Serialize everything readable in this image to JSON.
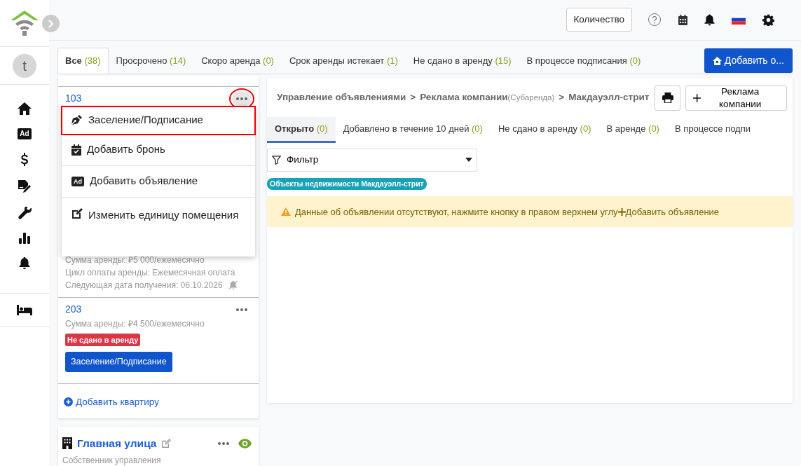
{
  "header": {
    "count_button": "Количество"
  },
  "sidebar": {
    "avatar": "t",
    "items": [
      {
        "kind": "home"
      },
      {
        "kind": "ad",
        "icon_text": "Ad"
      },
      {
        "kind": "dollar"
      },
      {
        "kind": "signature"
      },
      {
        "kind": "wrench"
      },
      {
        "kind": "chart"
      },
      {
        "kind": "bell"
      }
    ],
    "bottom_items": [
      {
        "kind": "bed"
      }
    ]
  },
  "tabs": [
    {
      "label": "Все",
      "count": "(38)",
      "selected": true
    },
    {
      "label": "Просрочено",
      "count": "(14)",
      "selected": false
    },
    {
      "label": "Скоро аренда",
      "count": "(0)",
      "selected": false
    },
    {
      "label": "Срок аренды истекает",
      "count": "(1)",
      "selected": false
    },
    {
      "label": "Не сдано в аренду",
      "count": "(15)",
      "selected": false
    },
    {
      "label": "В процессе подписания",
      "count": "(0)",
      "selected": false
    }
  ],
  "add_property_button": "Добавить о...",
  "units": [
    {
      "number": "103",
      "menu_open": true,
      "lines": [
        "Сумма аренды: ₽5 000/ежемесячно",
        "Цикл оплаты аренды: Ежемесячная оплата"
      ],
      "next_date_label": "Следующая дата получения:",
      "next_date": "06.10.2026",
      "reminder_muted": true
    },
    {
      "number": "203",
      "menu_open": false,
      "lines": [
        "Сумма аренды: ₽4 500/ежемесячно"
      ],
      "status": "Не сдано в аренду",
      "action": "Заселение/Подписание"
    }
  ],
  "add_unit": "Добавить квартиру",
  "context_menu": {
    "items": [
      {
        "kind": "sign",
        "label": "Заселение/Подписание",
        "highlighted": true
      },
      {
        "kind": "booking",
        "label": "Добавить бронь",
        "highlighted": false
      },
      {
        "kind": "ad",
        "icon_text": "Ad",
        "label": "Добавить объявление",
        "highlighted": false
      },
      {
        "kind": "edit",
        "label": "Изменить единицу помещения",
        "highlighted": false
      }
    ]
  },
  "second_property": {
    "name": "Главная улица",
    "subtitle": "Собственник управления"
  },
  "breadcrumb": [
    {
      "label": "Управление объявлениями"
    },
    {
      "separator": ">",
      "label": "Реклама компании",
      "note": "(Субаренда)"
    },
    {
      "separator": ">",
      "label": "Макдауэлл-стрит"
    }
  ],
  "company_ad_button": "Реклама компании",
  "listing_tabs": [
    {
      "label": "Открыто",
      "count": "(0)",
      "selected": true
    },
    {
      "label": "Добавлено в течение 10 дней",
      "count": "(0)",
      "selected": false
    },
    {
      "label": "Не сдано в аренду",
      "count": "(0)",
      "selected": false
    },
    {
      "label": "В аренде",
      "count": "(0)",
      "selected": false
    },
    {
      "label": "В процессе подпи",
      "selected": false
    }
  ],
  "filter": {
    "label": "Фильтр"
  },
  "tag": "Объекты недвижимости Макдауэлл-стрит",
  "alert": {
    "text": "Данные об объявлении отсутствуют, нажмите кнопку в правом верхнем углу",
    "link": "Добавить объявление"
  }
}
